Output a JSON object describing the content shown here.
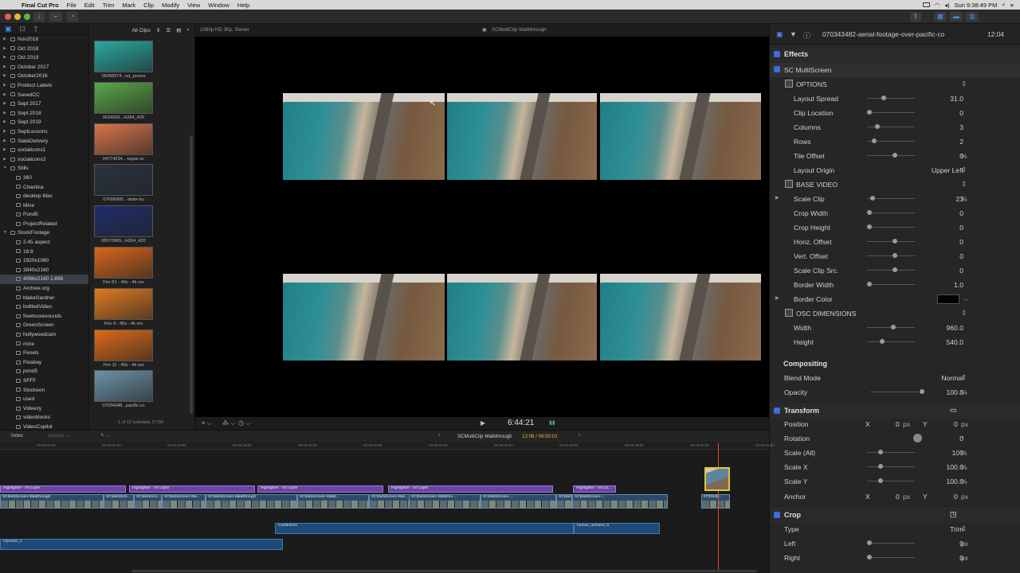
{
  "menubar": {
    "app": "Final Cut Pro",
    "items": [
      "File",
      "Edit",
      "Trim",
      "Mark",
      "Clip",
      "Modify",
      "View",
      "Window",
      "Help"
    ],
    "clock": "Sun 9:38:49 PM"
  },
  "library": {
    "items": [
      {
        "label": "Nov2018",
        "level": 1
      },
      {
        "label": "Oct 2018",
        "level": 1
      },
      {
        "label": "Oct 2019",
        "level": 1
      },
      {
        "label": "October 2017",
        "level": 1
      },
      {
        "label": "October2016",
        "level": 1
      },
      {
        "label": "Product Labels",
        "level": 1
      },
      {
        "label": "SavedCC",
        "level": 1
      },
      {
        "label": "Sept 2017",
        "level": 1
      },
      {
        "label": "Sept 2018",
        "level": 1
      },
      {
        "label": "Sept 2019",
        "level": 1
      },
      {
        "label": "SeptLessons",
        "level": 1
      },
      {
        "label": "SlateDelivery",
        "level": 1
      },
      {
        "label": "socialicons1",
        "level": 1
      },
      {
        "label": "socialicons2",
        "level": 1
      },
      {
        "label": "Stills",
        "level": 1,
        "open": true
      },
      {
        "label": "360",
        "level": 2
      },
      {
        "label": "Chaotica",
        "level": 2
      },
      {
        "label": "desktop Mac",
        "level": 2
      },
      {
        "label": "Mine",
        "level": 2
      },
      {
        "label": "Pond5",
        "level": 2
      },
      {
        "label": "ProjectRelated",
        "level": 2
      },
      {
        "label": "StockFootage",
        "level": 1,
        "open": true
      },
      {
        "label": "2.45 aspect",
        "level": 2
      },
      {
        "label": "16:9",
        "level": 2
      },
      {
        "label": "1920x1080",
        "level": 2
      },
      {
        "label": "3840x2160",
        "level": 2
      },
      {
        "label": "4096x2160 1.896",
        "level": 2,
        "selected": true
      },
      {
        "label": "Archive.org",
        "level": 2
      },
      {
        "label": "blakeGardner",
        "level": 2
      },
      {
        "label": "bottledVideo",
        "level": 2
      },
      {
        "label": "freetousesounds",
        "level": 2
      },
      {
        "label": "GreenScreen",
        "level": 2
      },
      {
        "label": "hollywoodcam",
        "level": 2
      },
      {
        "label": "mine",
        "level": 2
      },
      {
        "label": "Pexels",
        "level": 2
      },
      {
        "label": "Pixabay",
        "level": 2
      },
      {
        "label": "pond5",
        "level": 2
      },
      {
        "label": "SFFF",
        "level": 2
      },
      {
        "label": "Stockeon",
        "level": 2
      },
      {
        "label": "used",
        "level": 2
      },
      {
        "label": "Videezy",
        "level": 2
      },
      {
        "label": "videoblocks",
        "level": 2
      },
      {
        "label": "VideoCopilot",
        "level": 2
      }
    ]
  },
  "browser": {
    "filter": "All Clips",
    "clips": [
      {
        "label": "06058374...nd_prores",
        "color": "#2aa9a0"
      },
      {
        "label": "0634266...H264_420",
        "color": "#5aa64a"
      },
      {
        "label": "04774234...-lapse-sc",
        "color": "#d9744a"
      },
      {
        "label": "07696909...-state-bu",
        "color": "#2a3340"
      },
      {
        "label": "05570965...H264_420",
        "color": "#1f2d6a"
      },
      {
        "label": "Fire 61 - 45s - 4k res",
        "color": "#d8661c"
      },
      {
        "label": "Fire 9 - 45s - 4k res",
        "color": "#e07a20"
      },
      {
        "label": "Fire 11 - 45s - 4k res",
        "color": "#dd6a18"
      },
      {
        "label": "07034348...pacific-co",
        "color": "#6c93a8"
      }
    ],
    "footer": "1 of 12 selected, 27:00"
  },
  "viewer": {
    "format": "1080p HD 30p, Stereo",
    "title": "SCMultiClip Walkthrough",
    "timecode": "6:44:21"
  },
  "inspector": {
    "clip_name": "070343482-aerial-footage-over-pacific-co",
    "duration": "12:04",
    "effects_label": "Effects",
    "effect_name": "SC MultiScreen",
    "options_label": "OPTIONS",
    "base_video_label": "BASE VIDEO",
    "osc_label": "OSC DIMENSIONS",
    "params": [
      {
        "label": "Layout Spread",
        "value": "31.0",
        "unit": ""
      },
      {
        "label": "Clip Location",
        "value": "0",
        "unit": ""
      },
      {
        "label": "Columns",
        "value": "3",
        "unit": ""
      },
      {
        "label": "Rows",
        "value": "2",
        "unit": ""
      },
      {
        "label": "Tile Offset",
        "value": "0",
        "unit": "%"
      },
      {
        "label": "Layout Origin",
        "value": "Upper Left",
        "unit": ""
      },
      {
        "label": "Scale Clip",
        "value": "23",
        "unit": "%"
      },
      {
        "label": "Crop Width",
        "value": "0",
        "unit": ""
      },
      {
        "label": "Crop Height",
        "value": "0",
        "unit": ""
      },
      {
        "label": "Horiz. Offset",
        "value": "0",
        "unit": ""
      },
      {
        "label": "Vert. Offset",
        "value": "0",
        "unit": ""
      },
      {
        "label": "Scale Clip Src.",
        "value": "0",
        "unit": ""
      },
      {
        "label": "Border Width",
        "value": "1.0",
        "unit": ""
      },
      {
        "label": "Border Color",
        "value": "",
        "unit": ""
      },
      {
        "label": "Width",
        "value": "960.0",
        "unit": ""
      },
      {
        "label": "Height",
        "value": "540.0",
        "unit": ""
      }
    ],
    "compositing": {
      "label": "Compositing",
      "blend_label": "Blend Mode",
      "blend_value": "Normal",
      "opacity_label": "Opacity",
      "opacity_value": "100.0",
      "opacity_unit": "%"
    },
    "transform": {
      "label": "Transform",
      "position_label": "Position",
      "x_label": "X",
      "y_label": "Y",
      "pos_x": "0",
      "pos_y": "0",
      "px": "px",
      "rotation_label": "Rotation",
      "rotation_value": "0",
      "deg": "°",
      "scale_all_label": "Scale (All)",
      "scale_all_value": "100",
      "scale_x_label": "Scale X",
      "scale_x_value": "100.0",
      "scale_y_label": "Scale Y",
      "scale_y_value": "100.0",
      "pct": "%",
      "anchor_label": "Anchor",
      "anchor_x": "0",
      "anchor_y": "0"
    },
    "crop": {
      "label": "Crop",
      "type_label": "Type",
      "type_value": "Trim",
      "left_label": "Left",
      "left_value": "0",
      "right_label": "Right",
      "right_value": "0",
      "px": "px"
    }
  },
  "timeline": {
    "index_label": "Index",
    "project": "SCMultiClip Walkthrough",
    "timecode": "12:08 / 06:50:01",
    "ruler": [
      "00:00:00:00",
      "00:00:05:00",
      "00:00:10:00",
      "00:00:15:00",
      "00:00:20:00",
      "00:00:25:00",
      "00:00:30:00",
      "00:00:35:00",
      "00:00:40:00",
      "00:00:45:00",
      "00:00:50:00",
      "00:00:55:00"
    ],
    "titles": [
      "Highlighter - Art Layer",
      "Highlighter - Art Layer",
      "Highlighter - Art Layer",
      "Highlighter - Art Layer",
      "Highlighter - Art La..."
    ],
    "clips": [
      "SCMultiScreen-Walkthrough",
      "SCMultiScre...",
      "SCMultiScre...",
      "SCMultiScreen-Wa...",
      "SCMultiScreen-Walkthrough",
      "SCMultiScreen-Walkt...",
      "SCMultiScreen-Wal...",
      "SCMultiScreen-Walkthro...",
      "SCMultiScreen-...",
      "SCMultiScreen-...",
      "SCMultiScreen-...",
      "0703348..."
    ],
    "audio": [
      "Castleshire",
      "forever_ambient_6",
      "Operatic_3"
    ]
  }
}
